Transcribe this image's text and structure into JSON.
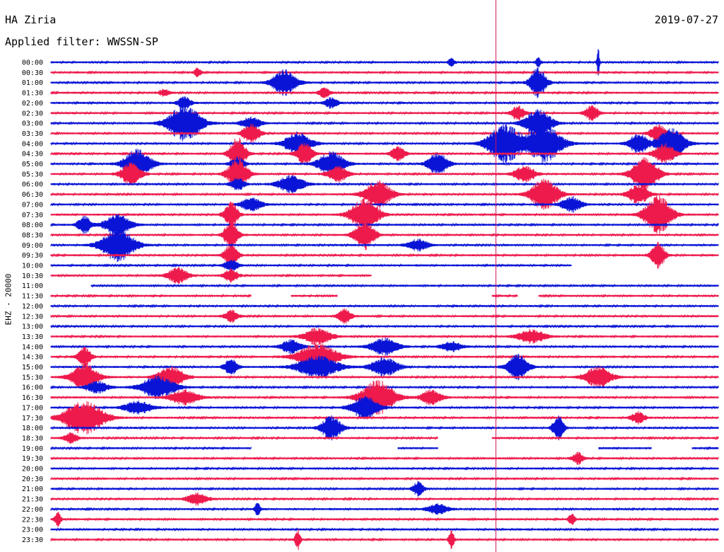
{
  "header": {
    "station": "HA Ziria",
    "date": "2019-07-27",
    "filter": "Applied filter: WWSSN-SP",
    "channel": "EHZ - 20000"
  },
  "colors": {
    "trace_a": "#0a14d6",
    "trace_b": "#ee1a4c",
    "marker": "#d0105a"
  },
  "chart_data": {
    "type": "line",
    "title": "HA Ziria",
    "subtitle": "Applied filter: WWSSN-SP",
    "ylabel": "EHZ - 20000",
    "xlabel": "",
    "grid": false,
    "legend": "none",
    "row_labels": [
      "00:00",
      "00:30",
      "01:00",
      "01:30",
      "02:00",
      "02:30",
      "03:00",
      "03:30",
      "04:00",
      "04:30",
      "05:00",
      "05:30",
      "06:00",
      "06:30",
      "07:00",
      "07:30",
      "08:00",
      "08:30",
      "09:00",
      "09:30",
      "10:00",
      "10:30",
      "11:00",
      "11:30",
      "12:00",
      "12:30",
      "13:00",
      "13:30",
      "14:00",
      "14:30",
      "15:00",
      "15:30",
      "16:00",
      "16:30",
      "17:00",
      "17:30",
      "18:00",
      "18:30",
      "19:00",
      "19:30",
      "20:00",
      "20:30",
      "21:00",
      "21:30",
      "22:00",
      "22:30",
      "23:00",
      "23:30"
    ],
    "minutes_per_row": 30,
    "series": [
      {
        "color": "#0a14d6",
        "rows": "even"
      },
      {
        "color": "#ee1a4c",
        "rows": "odd"
      }
    ],
    "events": [
      {
        "row": 0,
        "at": 0.82,
        "amp": 3.5,
        "width": 0.002
      },
      {
        "row": 0,
        "at": 0.6,
        "amp": 1.2,
        "width": 0.004
      },
      {
        "row": 0,
        "at": 0.73,
        "amp": 1.1,
        "width": 0.004
      },
      {
        "row": 1,
        "at": 0.22,
        "amp": 1.0,
        "width": 0.005
      },
      {
        "row": 2,
        "at": 0.35,
        "amp": 3.0,
        "width": 0.018
      },
      {
        "row": 2,
        "at": 0.73,
        "amp": 3.5,
        "width": 0.012
      },
      {
        "row": 3,
        "at": 0.41,
        "amp": 1.2,
        "width": 0.008
      },
      {
        "row": 3,
        "at": 0.17,
        "amp": 0.8,
        "width": 0.008
      },
      {
        "row": 4,
        "at": 0.2,
        "amp": 1.4,
        "width": 0.01
      },
      {
        "row": 4,
        "at": 0.42,
        "amp": 1.2,
        "width": 0.01
      },
      {
        "row": 5,
        "at": 0.81,
        "amp": 1.8,
        "width": 0.01
      },
      {
        "row": 5,
        "at": 0.7,
        "amp": 1.6,
        "width": 0.01
      },
      {
        "row": 6,
        "at": 0.2,
        "amp": 4.2,
        "width": 0.025
      },
      {
        "row": 6,
        "at": 0.73,
        "amp": 3.2,
        "width": 0.02
      },
      {
        "row": 6,
        "at": 0.3,
        "amp": 1.4,
        "width": 0.015
      },
      {
        "row": 7,
        "at": 0.3,
        "amp": 2.4,
        "width": 0.012
      },
      {
        "row": 7,
        "at": 0.91,
        "amp": 2.0,
        "width": 0.012
      },
      {
        "row": 8,
        "at": 0.37,
        "amp": 2.6,
        "width": 0.02
      },
      {
        "row": 8,
        "at": 0.68,
        "amp": 4.5,
        "width": 0.025
      },
      {
        "row": 8,
        "at": 0.74,
        "amp": 4.5,
        "width": 0.025
      },
      {
        "row": 8,
        "at": 0.93,
        "amp": 3.6,
        "width": 0.02
      },
      {
        "row": 8,
        "at": 0.88,
        "amp": 2.2,
        "width": 0.015
      },
      {
        "row": 9,
        "at": 0.28,
        "amp": 3.8,
        "width": 0.012
      },
      {
        "row": 9,
        "at": 0.38,
        "amp": 2.6,
        "width": 0.012
      },
      {
        "row": 9,
        "at": 0.52,
        "amp": 1.8,
        "width": 0.01
      },
      {
        "row": 9,
        "at": 0.92,
        "amp": 2.4,
        "width": 0.015
      },
      {
        "row": 10,
        "at": 0.13,
        "amp": 3.5,
        "width": 0.02
      },
      {
        "row": 10,
        "at": 0.42,
        "amp": 2.8,
        "width": 0.02
      },
      {
        "row": 10,
        "at": 0.58,
        "amp": 2.6,
        "width": 0.015
      },
      {
        "row": 10,
        "at": 0.28,
        "amp": 1.6,
        "width": 0.01
      },
      {
        "row": 11,
        "at": 0.12,
        "amp": 2.6,
        "width": 0.015
      },
      {
        "row": 11,
        "at": 0.28,
        "amp": 3.6,
        "width": 0.015
      },
      {
        "row": 11,
        "at": 0.43,
        "amp": 1.8,
        "width": 0.015
      },
      {
        "row": 11,
        "at": 0.71,
        "amp": 2.0,
        "width": 0.015
      },
      {
        "row": 11,
        "at": 0.89,
        "amp": 3.8,
        "width": 0.02
      },
      {
        "row": 12,
        "at": 0.36,
        "amp": 2.0,
        "width": 0.02
      },
      {
        "row": 12,
        "at": 0.28,
        "amp": 1.4,
        "width": 0.01
      },
      {
        "row": 13,
        "at": 0.49,
        "amp": 3.2,
        "width": 0.02
      },
      {
        "row": 13,
        "at": 0.74,
        "amp": 3.8,
        "width": 0.02
      },
      {
        "row": 13,
        "at": 0.88,
        "amp": 2.4,
        "width": 0.015
      },
      {
        "row": 14,
        "at": 0.3,
        "amp": 1.6,
        "width": 0.015
      },
      {
        "row": 14,
        "at": 0.78,
        "amp": 1.8,
        "width": 0.015
      },
      {
        "row": 15,
        "at": 0.47,
        "amp": 4.0,
        "width": 0.02
      },
      {
        "row": 15,
        "at": 0.27,
        "amp": 3.0,
        "width": 0.01
      },
      {
        "row": 15,
        "at": 0.91,
        "amp": 4.6,
        "width": 0.02
      },
      {
        "row": 16,
        "at": 0.05,
        "amp": 2.0,
        "width": 0.01
      },
      {
        "row": 16,
        "at": 0.1,
        "amp": 2.4,
        "width": 0.02
      },
      {
        "row": 17,
        "at": 0.47,
        "amp": 3.4,
        "width": 0.015
      },
      {
        "row": 17,
        "at": 0.27,
        "amp": 3.6,
        "width": 0.01
      },
      {
        "row": 18,
        "at": 0.1,
        "amp": 3.8,
        "width": 0.025
      },
      {
        "row": 18,
        "at": 0.55,
        "amp": 1.4,
        "width": 0.015
      },
      {
        "row": 19,
        "at": 0.27,
        "amp": 2.6,
        "width": 0.01
      },
      {
        "row": 19,
        "at": 0.91,
        "amp": 3.0,
        "width": 0.01
      },
      {
        "row": 20,
        "at": 0.27,
        "amp": 1.4,
        "width": 0.01
      },
      {
        "row": 21,
        "at": 0.19,
        "amp": 1.8,
        "width": 0.015
      },
      {
        "row": 21,
        "at": 0.27,
        "amp": 1.6,
        "width": 0.01
      },
      {
        "row": 25,
        "at": 0.44,
        "amp": 1.8,
        "width": 0.01
      },
      {
        "row": 25,
        "at": 0.27,
        "amp": 1.4,
        "width": 0.01
      },
      {
        "row": 27,
        "at": 0.4,
        "amp": 2.0,
        "width": 0.02
      },
      {
        "row": 27,
        "at": 0.72,
        "amp": 1.6,
        "width": 0.02
      },
      {
        "row": 28,
        "at": 0.36,
        "amp": 1.6,
        "width": 0.015
      },
      {
        "row": 28,
        "at": 0.5,
        "amp": 2.0,
        "width": 0.02
      },
      {
        "row": 28,
        "at": 0.6,
        "amp": 1.2,
        "width": 0.015
      },
      {
        "row": 29,
        "at": 0.4,
        "amp": 3.0,
        "width": 0.03
      },
      {
        "row": 29,
        "at": 0.05,
        "amp": 2.2,
        "width": 0.01
      },
      {
        "row": 30,
        "at": 0.4,
        "amp": 2.6,
        "width": 0.03
      },
      {
        "row": 30,
        "at": 0.5,
        "amp": 2.2,
        "width": 0.02
      },
      {
        "row": 30,
        "at": 0.7,
        "amp": 3.0,
        "width": 0.015
      },
      {
        "row": 30,
        "at": 0.27,
        "amp": 2.0,
        "width": 0.01
      },
      {
        "row": 31,
        "at": 0.05,
        "amp": 3.2,
        "width": 0.02
      },
      {
        "row": 31,
        "at": 0.18,
        "amp": 2.4,
        "width": 0.02
      },
      {
        "row": 31,
        "at": 0.82,
        "amp": 2.4,
        "width": 0.02
      },
      {
        "row": 32,
        "at": 0.16,
        "amp": 2.6,
        "width": 0.025
      },
      {
        "row": 32,
        "at": 0.07,
        "amp": 1.4,
        "width": 0.015
      },
      {
        "row": 33,
        "at": 0.49,
        "amp": 4.0,
        "width": 0.025
      },
      {
        "row": 33,
        "at": 0.2,
        "amp": 1.8,
        "width": 0.02
      },
      {
        "row": 33,
        "at": 0.57,
        "amp": 1.8,
        "width": 0.015
      },
      {
        "row": 34,
        "at": 0.47,
        "amp": 2.6,
        "width": 0.02
      },
      {
        "row": 34,
        "at": 0.13,
        "amp": 1.6,
        "width": 0.02
      },
      {
        "row": 35,
        "at": 0.05,
        "amp": 3.8,
        "width": 0.03
      },
      {
        "row": 35,
        "at": 0.88,
        "amp": 1.4,
        "width": 0.01
      },
      {
        "row": 36,
        "at": 0.42,
        "amp": 2.8,
        "width": 0.015
      },
      {
        "row": 36,
        "at": 0.76,
        "amp": 3.0,
        "width": 0.008
      },
      {
        "row": 37,
        "at": 0.03,
        "amp": 1.2,
        "width": 0.01
      },
      {
        "row": 39,
        "at": 0.79,
        "amp": 1.4,
        "width": 0.008
      },
      {
        "row": 42,
        "at": 0.55,
        "amp": 1.6,
        "width": 0.008
      },
      {
        "row": 43,
        "at": 0.22,
        "amp": 1.4,
        "width": 0.015
      },
      {
        "row": 44,
        "at": 0.58,
        "amp": 1.2,
        "width": 0.015
      },
      {
        "row": 44,
        "at": 0.31,
        "amp": 1.8,
        "width": 0.004
      },
      {
        "row": 45,
        "at": 0.01,
        "amp": 1.6,
        "width": 0.005
      },
      {
        "row": 45,
        "at": 0.78,
        "amp": 1.4,
        "width": 0.005
      },
      {
        "row": 47,
        "at": 0.37,
        "amp": 2.4,
        "width": 0.004
      },
      {
        "row": 47,
        "at": 0.6,
        "amp": 2.2,
        "width": 0.004
      }
    ],
    "gaps": [
      {
        "row": 20,
        "from": 0.78,
        "to": 1.0
      },
      {
        "row": 21,
        "from": 0.48,
        "to": 1.0
      },
      {
        "row": 22,
        "from": 0.0,
        "to": 0.06
      },
      {
        "row": 23,
        "from": 0.3,
        "to": 0.36
      },
      {
        "row": 23,
        "from": 0.43,
        "to": 0.66
      },
      {
        "row": 23,
        "from": 0.7,
        "to": 0.73
      },
      {
        "row": 37,
        "from": 0.58,
        "to": 0.66
      },
      {
        "row": 38,
        "from": 0.3,
        "to": 0.52
      },
      {
        "row": 38,
        "from": 0.58,
        "to": 0.82
      },
      {
        "row": 38,
        "from": 0.9,
        "to": 0.96
      }
    ],
    "marker_minute": 20
  }
}
